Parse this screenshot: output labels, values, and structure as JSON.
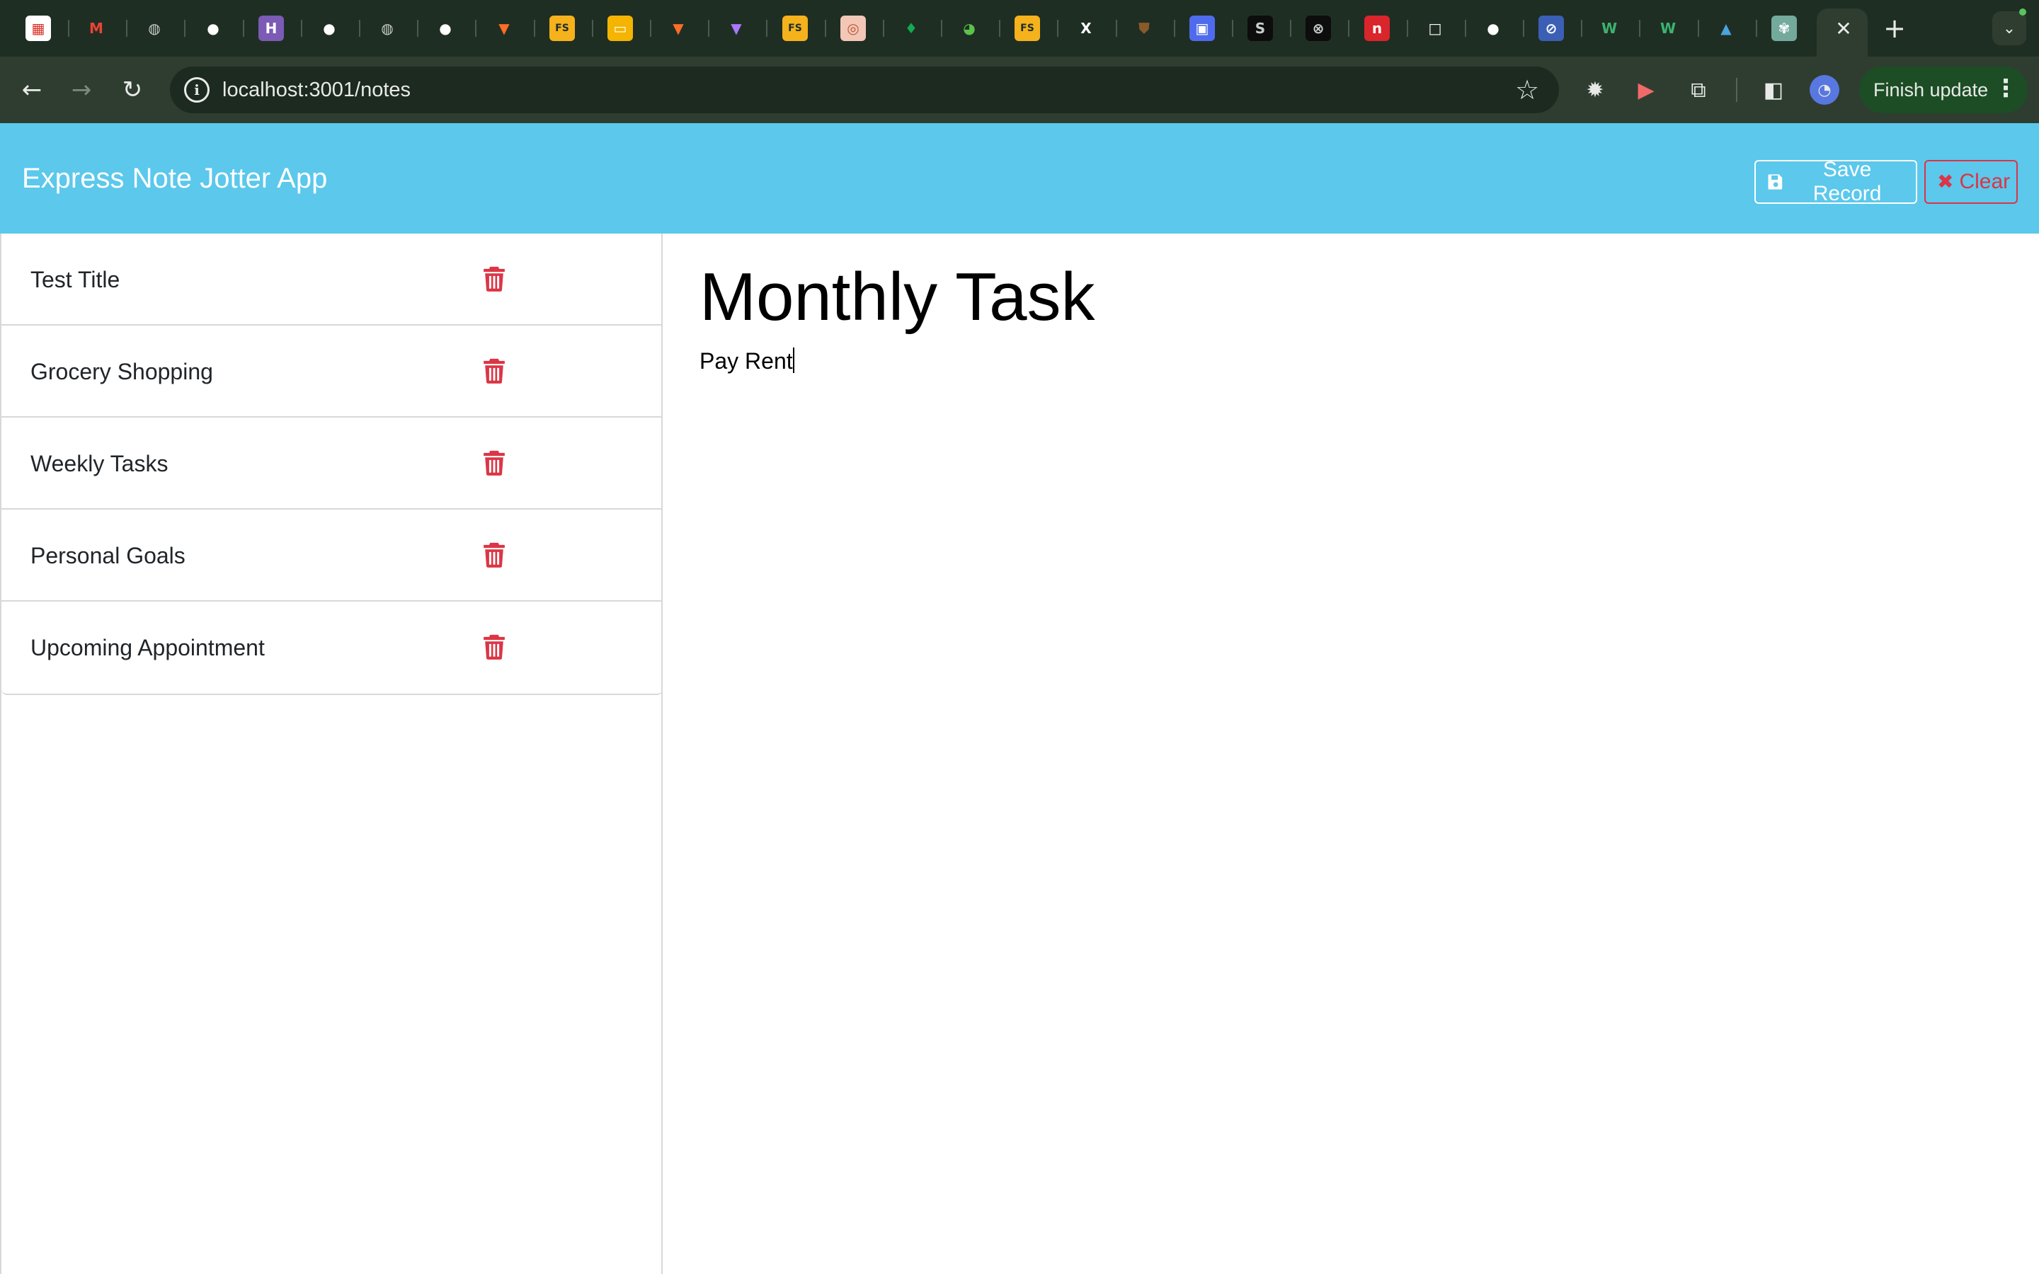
{
  "browser": {
    "tabs": [
      {
        "icon": "calendar-icon",
        "glyph": "▦",
        "bg": "#ffffff",
        "fg": "#d93025",
        "active": false
      },
      {
        "icon": "gmail-icon",
        "glyph": "M",
        "bg": "transparent",
        "fg": "#ea4335",
        "active": false
      },
      {
        "icon": "globe-icon",
        "glyph": "◍",
        "bg": "transparent",
        "fg": "#c9cfca",
        "active": false
      },
      {
        "icon": "github-icon",
        "glyph": "●",
        "bg": "transparent",
        "fg": "#ffffff",
        "active": false
      },
      {
        "icon": "heroku-icon",
        "glyph": "H",
        "bg": "#7b5bb5",
        "fg": "#ffffff",
        "active": false
      },
      {
        "icon": "github-icon",
        "glyph": "●",
        "bg": "transparent",
        "fg": "#ffffff",
        "active": false
      },
      {
        "icon": "globe-icon",
        "glyph": "◍",
        "bg": "transparent",
        "fg": "#c9cfca",
        "active": false
      },
      {
        "icon": "github-icon",
        "glyph": "●",
        "bg": "transparent",
        "fg": "#ffffff",
        "active": false
      },
      {
        "icon": "gitlab-icon",
        "glyph": "▼",
        "bg": "transparent",
        "fg": "#fc6d26",
        "active": false
      },
      {
        "icon": "fs-icon",
        "glyph": "FS",
        "bg": "#f5b21c",
        "fg": "#1f2e23",
        "active": false
      },
      {
        "icon": "slides-icon",
        "glyph": "▭",
        "bg": "#f4b400",
        "fg": "#ffffff",
        "active": false
      },
      {
        "icon": "gitlab-icon",
        "glyph": "▼",
        "bg": "transparent",
        "fg": "#fc6d26",
        "active": false
      },
      {
        "icon": "vite-icon",
        "glyph": "▼",
        "bg": "transparent",
        "fg": "#a978ff",
        "active": false
      },
      {
        "icon": "fs-icon",
        "glyph": "FS",
        "bg": "#f5b21c",
        "fg": "#1f2e23",
        "active": false
      },
      {
        "icon": "donut-icon",
        "glyph": "◎",
        "bg": "#f2c7b6",
        "fg": "#c0563a",
        "active": false
      },
      {
        "icon": "mongodb-icon",
        "glyph": "♦",
        "bg": "transparent",
        "fg": "#13aa52",
        "active": false
      },
      {
        "icon": "frog-icon",
        "glyph": "◕",
        "bg": "transparent",
        "fg": "#5bc24a",
        "active": false
      },
      {
        "icon": "fs-icon",
        "glyph": "FS",
        "bg": "#f5b21c",
        "fg": "#1f2e23",
        "active": false
      },
      {
        "icon": "x-icon",
        "glyph": "X",
        "bg": "transparent",
        "fg": "#ffffff",
        "active": false
      },
      {
        "icon": "shield-icon",
        "glyph": "⛊",
        "bg": "transparent",
        "fg": "#8a5a2b",
        "active": false
      },
      {
        "icon": "printer-icon",
        "glyph": "▣",
        "bg": "#4f6bed",
        "fg": "#ffffff",
        "active": false
      },
      {
        "icon": "s-circle-icon",
        "glyph": "S",
        "bg": "#0d0d0d",
        "fg": "#c9cfca",
        "active": false
      },
      {
        "icon": "x-circle-icon",
        "glyph": "⊗",
        "bg": "#0d0d0d",
        "fg": "#c9cfca",
        "active": false
      },
      {
        "icon": "n-square-icon",
        "glyph": "n",
        "bg": "#d9252b",
        "fg": "#ffffff",
        "active": false
      },
      {
        "icon": "square-icon",
        "glyph": "□",
        "bg": "transparent",
        "fg": "#ffffff",
        "active": false
      },
      {
        "icon": "github-icon",
        "glyph": "●",
        "bg": "transparent",
        "fg": "#ffffff",
        "active": false
      },
      {
        "icon": "compass-icon",
        "glyph": "⊘",
        "bg": "#3b5fb5",
        "fg": "#ffffff",
        "active": false
      },
      {
        "icon": "w-icon",
        "glyph": "W",
        "bg": "transparent",
        "fg": "#3cb371",
        "active": false
      },
      {
        "icon": "w-icon",
        "glyph": "W",
        "bg": "transparent",
        "fg": "#3cb371",
        "active": false
      },
      {
        "icon": "mountain-icon",
        "glyph": "▲",
        "bg": "transparent",
        "fg": "#4aa3df",
        "active": false
      },
      {
        "icon": "openai-icon",
        "glyph": "✾",
        "bg": "#74aa9c",
        "fg": "#ffffff",
        "active": false
      }
    ],
    "active_tab_close": "✕",
    "new_tab": "+",
    "tab_search": "⌄",
    "url": "localhost:3001/notes",
    "info_icon": "i",
    "star_icon": "☆",
    "finish_update_label": "Finish update",
    "menu_dots": "⋮"
  },
  "app": {
    "title": "Express Note Jotter App",
    "save_label": "Save Record",
    "clear_label": "Clear",
    "notes": [
      {
        "title": "Test Title"
      },
      {
        "title": "Grocery Shopping"
      },
      {
        "title": "Weekly Tasks"
      },
      {
        "title": "Personal Goals"
      },
      {
        "title": "Upcoming Appointment"
      }
    ],
    "active_note": {
      "title": "Monthly Task",
      "body": "Pay Rent"
    },
    "colors": {
      "navbar": "#5bc8ec",
      "danger": "#dc3545"
    }
  }
}
